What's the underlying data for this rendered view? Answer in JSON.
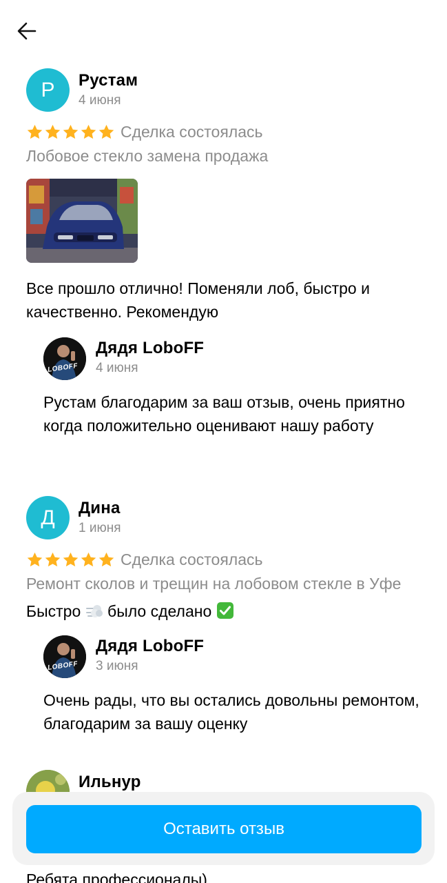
{
  "header": {
    "back_icon": "arrow-left-icon"
  },
  "reviews": [
    {
      "author": "Рустам",
      "avatar_letter": "Р",
      "avatar_color": "#1fbcd2",
      "date": "4 июня",
      "stars": 5,
      "status": "Сделка состоялась",
      "service": "Лобовое стекло замена продажа",
      "text": "Все прошло отлично! Поменяли лоб, быстро и качественно. Рекомендую",
      "reply": {
        "author": "Дядя LoboFF",
        "avatar_caption": "LOBOFF",
        "date": "4 июня",
        "text": "Рустам благодарим за ваш отзыв, очень приятно когда положительно оценивают нашу работу"
      }
    },
    {
      "author": "Дина",
      "avatar_letter": "Д",
      "avatar_color": "#1fbcd2",
      "date": "1 июня",
      "stars": 5,
      "status": "Сделка состоялась",
      "service": "Ремонт сколов и трещин на лобовом стекле в Уфе",
      "text_part1": "Быстро",
      "text_part2": "было сделано",
      "reply": {
        "author": "Дядя LoboFF",
        "avatar_caption": "LOBOFF",
        "date": "3 июня",
        "text": "Очень рады, что вы остались довольны ремонтом, благодарим за вашу оценку"
      }
    },
    {
      "author": "Ильнур",
      "text_peek": "Ребята профессионалы)"
    }
  ],
  "colors": {
    "accent": "#00aaff",
    "star": "#ffb21e",
    "muted": "#8c8c8c",
    "avatar": "#1fbcd2"
  },
  "cta": {
    "label": "Оставить отзыв"
  }
}
